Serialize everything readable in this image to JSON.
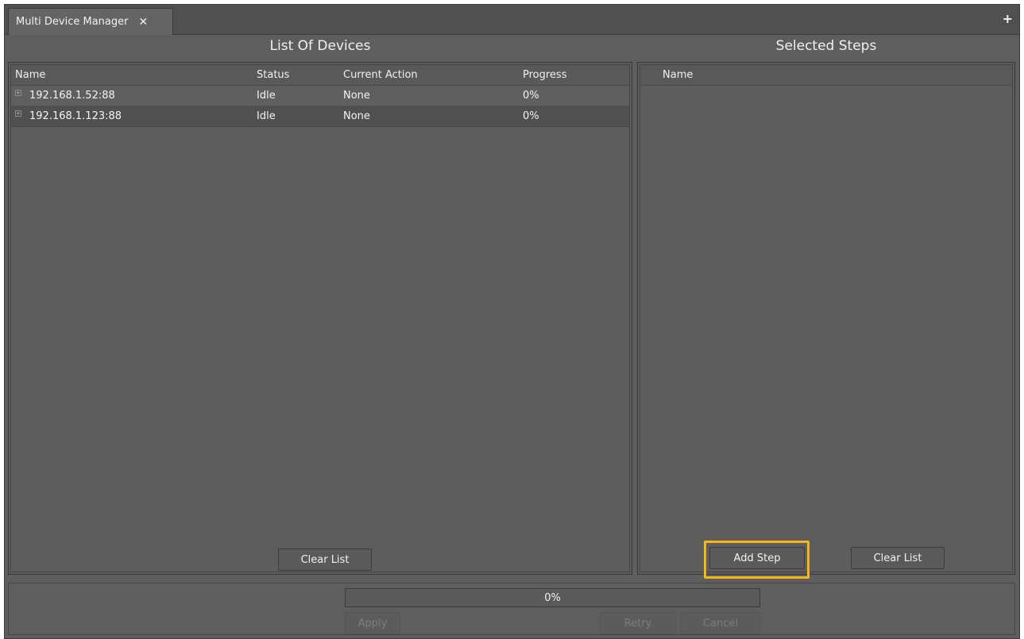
{
  "tab": {
    "title": "Multi Device Manager",
    "close_icon": "close-icon"
  },
  "toolbar": {
    "add_icon": "plus-icon"
  },
  "devices": {
    "title": "List Of Devices",
    "columns": [
      "Name",
      "Status",
      "Current Action",
      "Progress"
    ],
    "rows": [
      {
        "name": "192.168.1.52:88",
        "status": "Idle",
        "action": "None",
        "progress": "0%"
      },
      {
        "name": "192.168.1.123:88",
        "status": "Idle",
        "action": "None",
        "progress": "0%"
      }
    ],
    "clear_label": "Clear List"
  },
  "steps": {
    "title": "Selected Steps",
    "columns": [
      "Name"
    ],
    "add_label": "Add Step",
    "clear_label": "Clear List"
  },
  "footer": {
    "progress_text": "0%",
    "progress_value": 0,
    "apply_label": "Apply",
    "retry_label": "Retry",
    "cancel_label": "Cancel"
  },
  "colors": {
    "highlight": "#f6b619",
    "background": "#5e5e5e"
  }
}
